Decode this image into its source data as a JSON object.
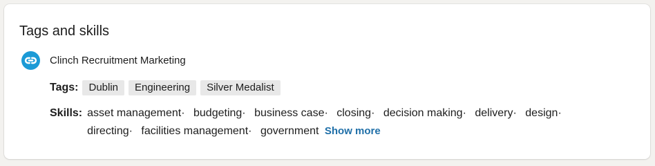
{
  "section": {
    "title": "Tags and skills"
  },
  "source": {
    "name": "Clinch Recruitment Marketing",
    "logo_icon": "clinch-link-icon",
    "logo_color": "#1b9ad6"
  },
  "tags": {
    "label": "Tags:",
    "items": [
      "Dublin",
      "Engineering",
      "Silver Medalist"
    ]
  },
  "skills": {
    "label": "Skills:",
    "separator": "·",
    "items": [
      "asset management",
      "budgeting",
      "business case",
      "closing",
      "decision making",
      "delivery",
      "design",
      "directing",
      "facilities management",
      "government"
    ],
    "show_more_label": "Show more",
    "link_color": "#1f6fa8"
  }
}
